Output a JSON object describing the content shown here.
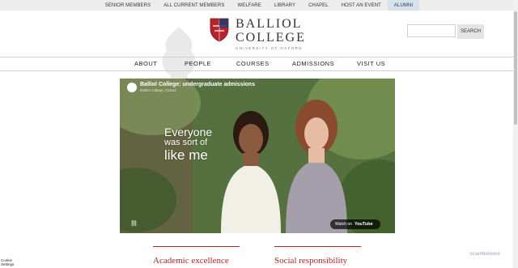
{
  "topbar": {
    "links": [
      "SENIOR MEMBERS",
      "ALL CURRENT MEMBERS",
      "WELFARE",
      "LIBRARY",
      "CHAPEL",
      "HOST AN EVENT",
      "ALUMNI"
    ],
    "active": "ALUMNI"
  },
  "logo": {
    "line1": "BALLIOL",
    "line2": "COLLEGE",
    "line3": "UNIVERSITY OF OXFORD"
  },
  "search": {
    "value": "",
    "button": "SEARCH"
  },
  "mainnav": {
    "items": [
      "ABOUT",
      "PEOPLE",
      "COURSES",
      "ADMISSIONS",
      "VISIT US"
    ]
  },
  "video": {
    "title": "Balliol College: undergraduate admissions",
    "channel": "Balliol College, Oxford",
    "caption_line1": "Everyone",
    "caption_line2": "was sort of",
    "caption_line3": "like me",
    "watch_label": "Watch on",
    "youtube_label": "YouTube"
  },
  "features": [
    "Academic excellence",
    "Social responsibility"
  ],
  "cookie": {
    "line1": "Cookie",
    "line2": "Settings"
  },
  "overlay": {
    "scanmalware": "ScanMalware"
  },
  "colors": {
    "accent": "#b8242b",
    "topbar_bg": "#ededed",
    "alumni_bg": "#d6e3ef"
  }
}
